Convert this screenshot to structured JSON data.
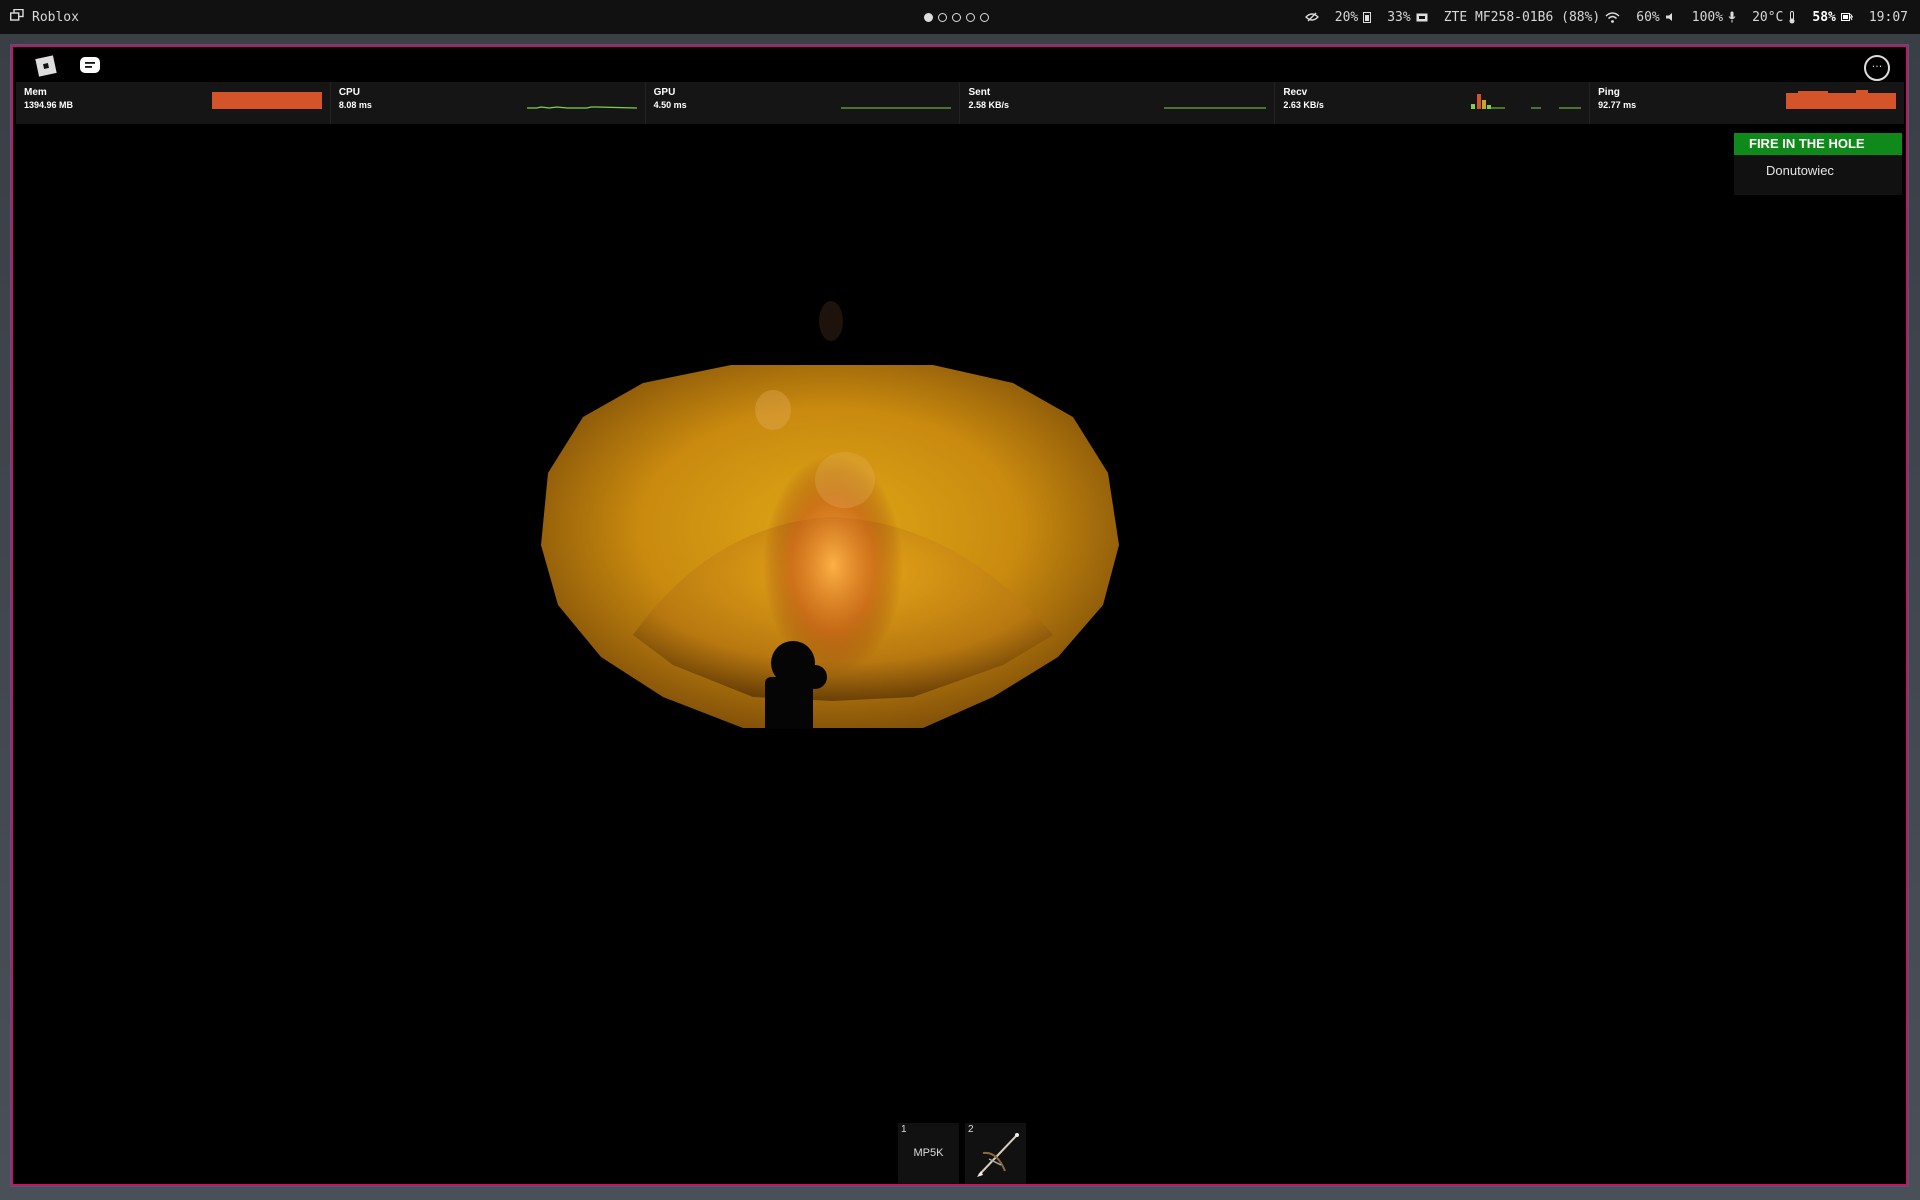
{
  "topbar": {
    "app_title": "Roblox",
    "workspaces": 5,
    "active_workspace": 1,
    "privacy_label": "20%",
    "battery_small_label": "33%",
    "network_name": "ZTE MF258-01B6 (88%)",
    "brightness_label": "60%",
    "volume_label": "100%",
    "temperature_label": "20°C",
    "battery_label": "58%",
    "clock": "19:07"
  },
  "stats": [
    {
      "label": "Mem",
      "value": "1394.96 MB",
      "graph": "bar-orange"
    },
    {
      "label": "CPU",
      "value": "8.08 ms",
      "graph": "line-green"
    },
    {
      "label": "GPU",
      "value": "4.50 ms",
      "graph": "line-green"
    },
    {
      "label": "Sent",
      "value": "2.58 KB/s",
      "graph": "line-green"
    },
    {
      "label": "Recv",
      "value": "2.63 KB/s",
      "graph": "bars-mixed"
    },
    {
      "label": "Ping",
      "value": "92.77 ms",
      "graph": "bar-orange"
    }
  ],
  "leaderboard": {
    "team": "FIRE IN THE HOLE",
    "team_color": "#0f8a1a",
    "player": "Donutowiec"
  },
  "hotbar": [
    {
      "slot": "1",
      "name": "MP5K"
    },
    {
      "slot": "2",
      "name": "",
      "icon": "crossbow-icon"
    }
  ],
  "colors": {
    "window_border": "#c2185b",
    "bar_orange": "#d4542a",
    "graph_green": "#7fd14a"
  }
}
